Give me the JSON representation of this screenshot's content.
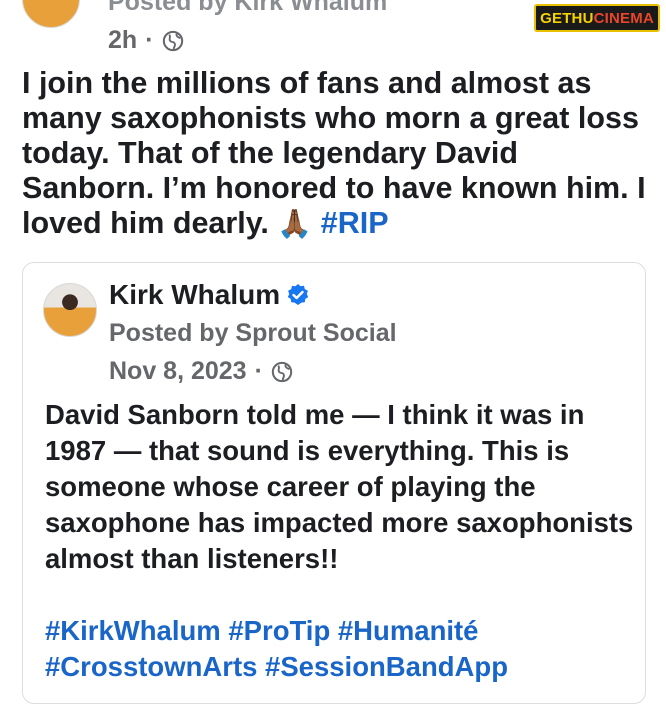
{
  "post": {
    "posted_by": "Posted by Kirk Whalum",
    "time": "2h",
    "separator": "·",
    "globe_icon": "globe-icon",
    "text": "I join the millions of fans and almost as many saxophonists who morn a great loss today. That of the legendary David Sanborn. I’m honored to have known him. I loved him dearly.",
    "emoji": "🙏🏾",
    "hashtag": "#RIP"
  },
  "watermark": {
    "part1": "GETHU",
    "part2": "CINEMA"
  },
  "shared": {
    "author": "Kirk Whalum",
    "verified_icon": "verified-badge-icon",
    "posted_by": "Posted by Sprout Social",
    "date": "Nov 8, 2023",
    "separator": "·",
    "text": "David Sanborn told me — I think it was in 1987 — that sound is everything. This is someone whose career of playing the saxophone has impacted more saxophonists almost than listeners!!",
    "hashtags_line1": "#KirkWhalum #ProTip #Humanité",
    "hashtags_line2": "#CrosstownArts #SessionBandApp"
  },
  "colors": {
    "link": "#1a66c8",
    "meta": "#65676b",
    "text": "#1c1e21",
    "verified": "#1877f2"
  }
}
